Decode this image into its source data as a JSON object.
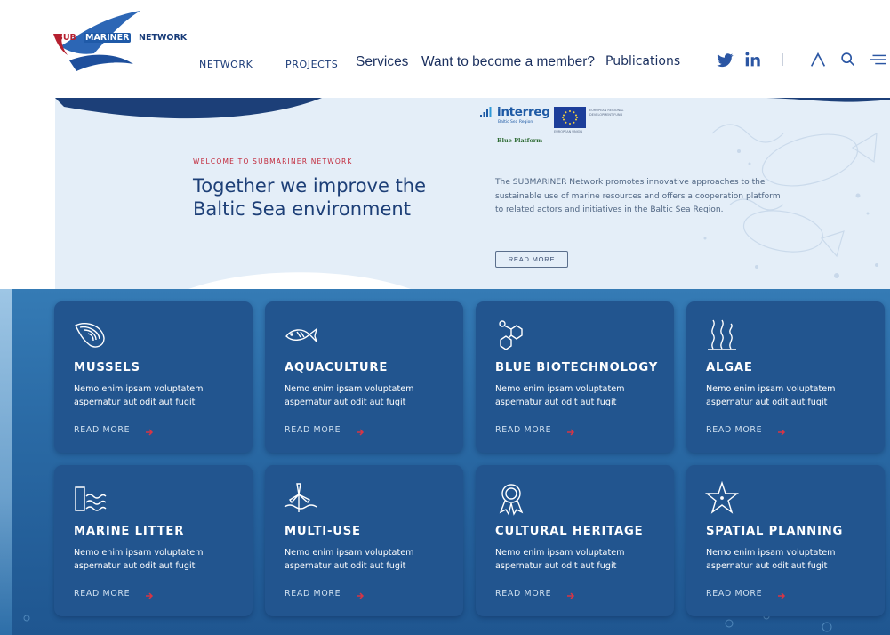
{
  "header": {
    "logo": {
      "sub": "SUB",
      "marine": "MARINER",
      "network": "NETWORK"
    },
    "nav": [
      {
        "label": "NETWORK"
      },
      {
        "label": "PROJECTS"
      },
      {
        "label": "Services"
      },
      {
        "label": "Want to become a member?"
      },
      {
        "label": "Publications"
      }
    ],
    "icons": [
      "twitter-icon",
      "linkedin-icon",
      "user-icon",
      "search-icon",
      "menu-icon"
    ]
  },
  "hero": {
    "eyebrow": "WELCOME TO SUBMARINER NETWORK",
    "title": "Together we improve the Baltic Sea environment",
    "interreg": {
      "word": "interreg",
      "region": "Baltic Sea Region",
      "eu_text": "EUROPEAN REGIONAL DEVELOPMENT FUND",
      "eu_union": "EUROPEAN UNION",
      "platform": "Blue Platform"
    },
    "description": "The SUBMARINER Network promotes innovative approaches to the sustainable use of marine resources and offers a cooperation platform to related actors and initiatives in the Baltic Sea Region.",
    "button": "READ MORE"
  },
  "cards": [
    {
      "title": "MUSSELS",
      "icon": "mussel-icon",
      "description": "Nemo enim ipsam voluptatem aspernatur aut odit aut fugit",
      "more": "READ MORE"
    },
    {
      "title": "AQUACULTURE",
      "icon": "fish-icon",
      "description": "Nemo enim ipsam voluptatem aspernatur aut odit aut fugit",
      "more": "READ MORE"
    },
    {
      "title": "BLUE BIOTECHNOLOGY",
      "icon": "molecule-icon",
      "description": "Nemo enim ipsam voluptatem aspernatur aut odit aut fugit",
      "more": "READ MORE"
    },
    {
      "title": "ALGAE",
      "icon": "seaweed-icon",
      "description": "Nemo enim ipsam voluptatem aspernatur aut odit aut fugit",
      "more": "READ MORE"
    },
    {
      "title": "MARINE LITTER",
      "icon": "litter-waves-icon",
      "description": "Nemo enim ipsam voluptatem aspernatur aut odit aut fugit",
      "more": "READ MORE"
    },
    {
      "title": "MULTI-USE",
      "icon": "wind-turbine-icon",
      "description": "Nemo enim ipsam voluptatem aspernatur aut odit aut fugit",
      "more": "READ MORE"
    },
    {
      "title": "CULTURAL HERITAGE",
      "icon": "heritage-award-icon",
      "description": "Nemo enim ipsam voluptatem aspernatur aut odit aut fugit",
      "more": "READ MORE"
    },
    {
      "title": "SPATIAL PLANNING",
      "icon": "starfish-icon",
      "description": "Nemo enim ipsam voluptatem aspernatur aut odit aut fugit",
      "more": "READ MORE"
    }
  ],
  "colors": {
    "navy": "#1b3b78",
    "accent_red": "#c2283a",
    "card": "#22558f",
    "sea": "#2a6aa5"
  }
}
